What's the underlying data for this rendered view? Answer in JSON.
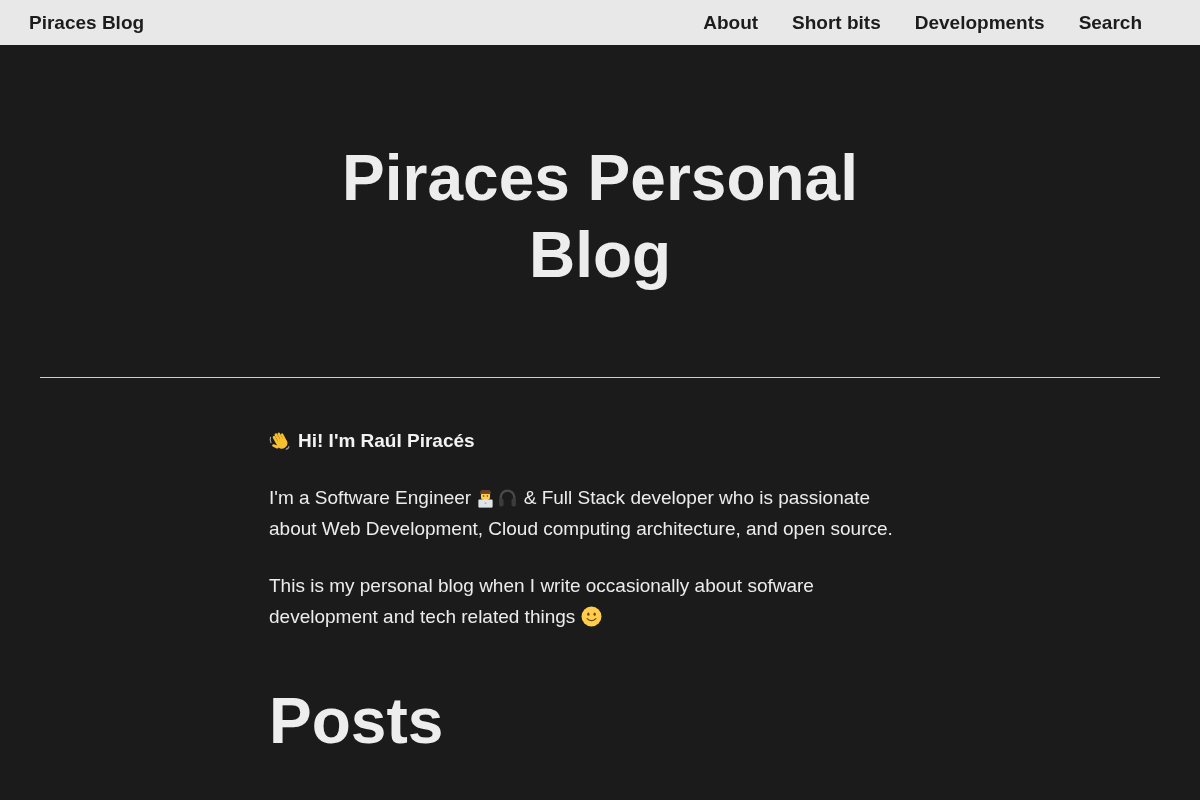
{
  "header": {
    "brand": "Piraces Blog",
    "nav": [
      "About",
      "Short bits",
      "Developments",
      "Search"
    ]
  },
  "hero": {
    "title": "Piraces Personal Blog"
  },
  "intro": {
    "greeting": "Hi! I'm Raúl Piracés",
    "paragraphs": [
      {
        "text": "I'm a Software Engineer",
        "text_after_icons": "& Full Stack developer who is passionate about Web Development, Cloud computing architecture, and open source."
      },
      {
        "text": "This is my personal blog when I write occasionally about sofware development and tech related things"
      }
    ]
  },
  "posts": {
    "heading": "Posts"
  }
}
